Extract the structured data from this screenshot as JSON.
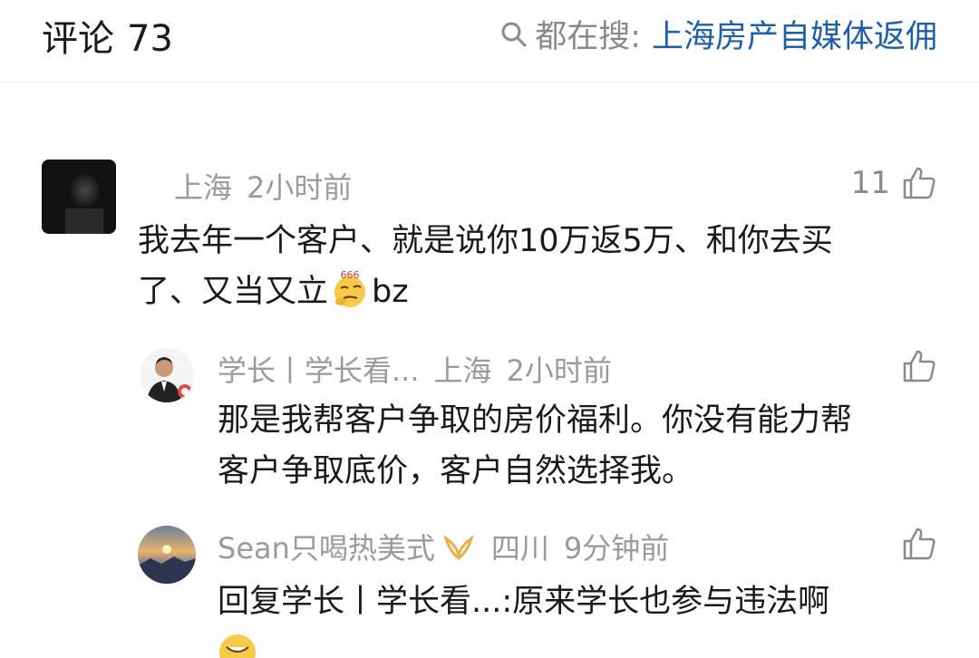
{
  "header": {
    "title": "评论",
    "count": "73",
    "search_prefix": "都在搜:",
    "search_term": "上海房产自媒体返佣",
    "search_icon": "search-icon"
  },
  "comments": [
    {
      "location": "上海",
      "time": "2小时前",
      "likes": "11",
      "text_line1": "我去年一个客户、就是说你10万返5万、和你去买",
      "text_line2_a": "了、又当又立",
      "emoji_1": "666",
      "text_line2_b": "bz"
    },
    {
      "author": "学长丨学长看...",
      "location": "上海",
      "time": "2小时前",
      "text_line1": "那是我帮客户争取的房价福利。你没有能力帮",
      "text_line2": "客户争取底价，客户自然选择我。"
    },
    {
      "author": "Sean只喝热美式",
      "location": "四川",
      "time": "9分钟前",
      "text_line1": "回复学长丨学长看...:原来学长也参与违法啊"
    }
  ],
  "colors": {
    "meta_gray": "#9a9a9a",
    "link_blue": "#1f5fa8",
    "text": "#1a1a1a"
  }
}
